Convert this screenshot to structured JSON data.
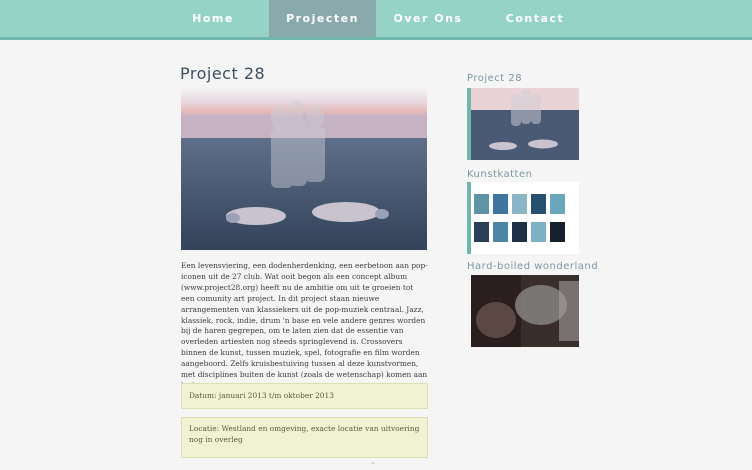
{
  "nav": {
    "items": [
      {
        "label": "Home",
        "active": false
      },
      {
        "label": "Projecten",
        "active": true
      },
      {
        "label": "Over Ons",
        "active": false
      },
      {
        "label": "Contact",
        "active": false
      }
    ]
  },
  "main": {
    "title": "Project 28",
    "description": "Een levensviering, een dodenherdenking, een eerbetoon aan pop-iconen uit de 27 club. Wat ooit begon als een concept album (www.project28.org) heeft nu de ambitie om uit te groeien tot een comunity art project. In dit project staan nieuwe arrangementen van klassiekers uit de pop-muziek centraal. Jazz, klassiek, rock, indie, drum 'n base en vele andere genres worden bij de haren gegrepen, om te laten zien dat de essentie van overleden artiesten nog steeds springlevend is. Crossovers binnen de kunst, tussen muziek, spel, fotografie en film worden aangeboord. Zelfs kruisbestuiving tussen al deze kunstvormen, met disciplines buiten de kunst (zoals de wetenschap) komen aan bod.",
    "datum": "Datum: januari 2013 t/m oktober 2013",
    "locatie": "Locatie: Westland en omgeving, exacte locatie van uitvoering nog in overleg"
  },
  "sidebar": {
    "projects": [
      {
        "title": "Project 28"
      },
      {
        "title": "Kunstkatten"
      },
      {
        "title": "Hard-boiled wonderland"
      }
    ]
  },
  "colors": {
    "nav_bg": "#96d3c7",
    "nav_active": "#8aa9ad",
    "accent": "#6fb7ac",
    "title": "#3e4d60",
    "info_bg": "#f1f2d4"
  }
}
